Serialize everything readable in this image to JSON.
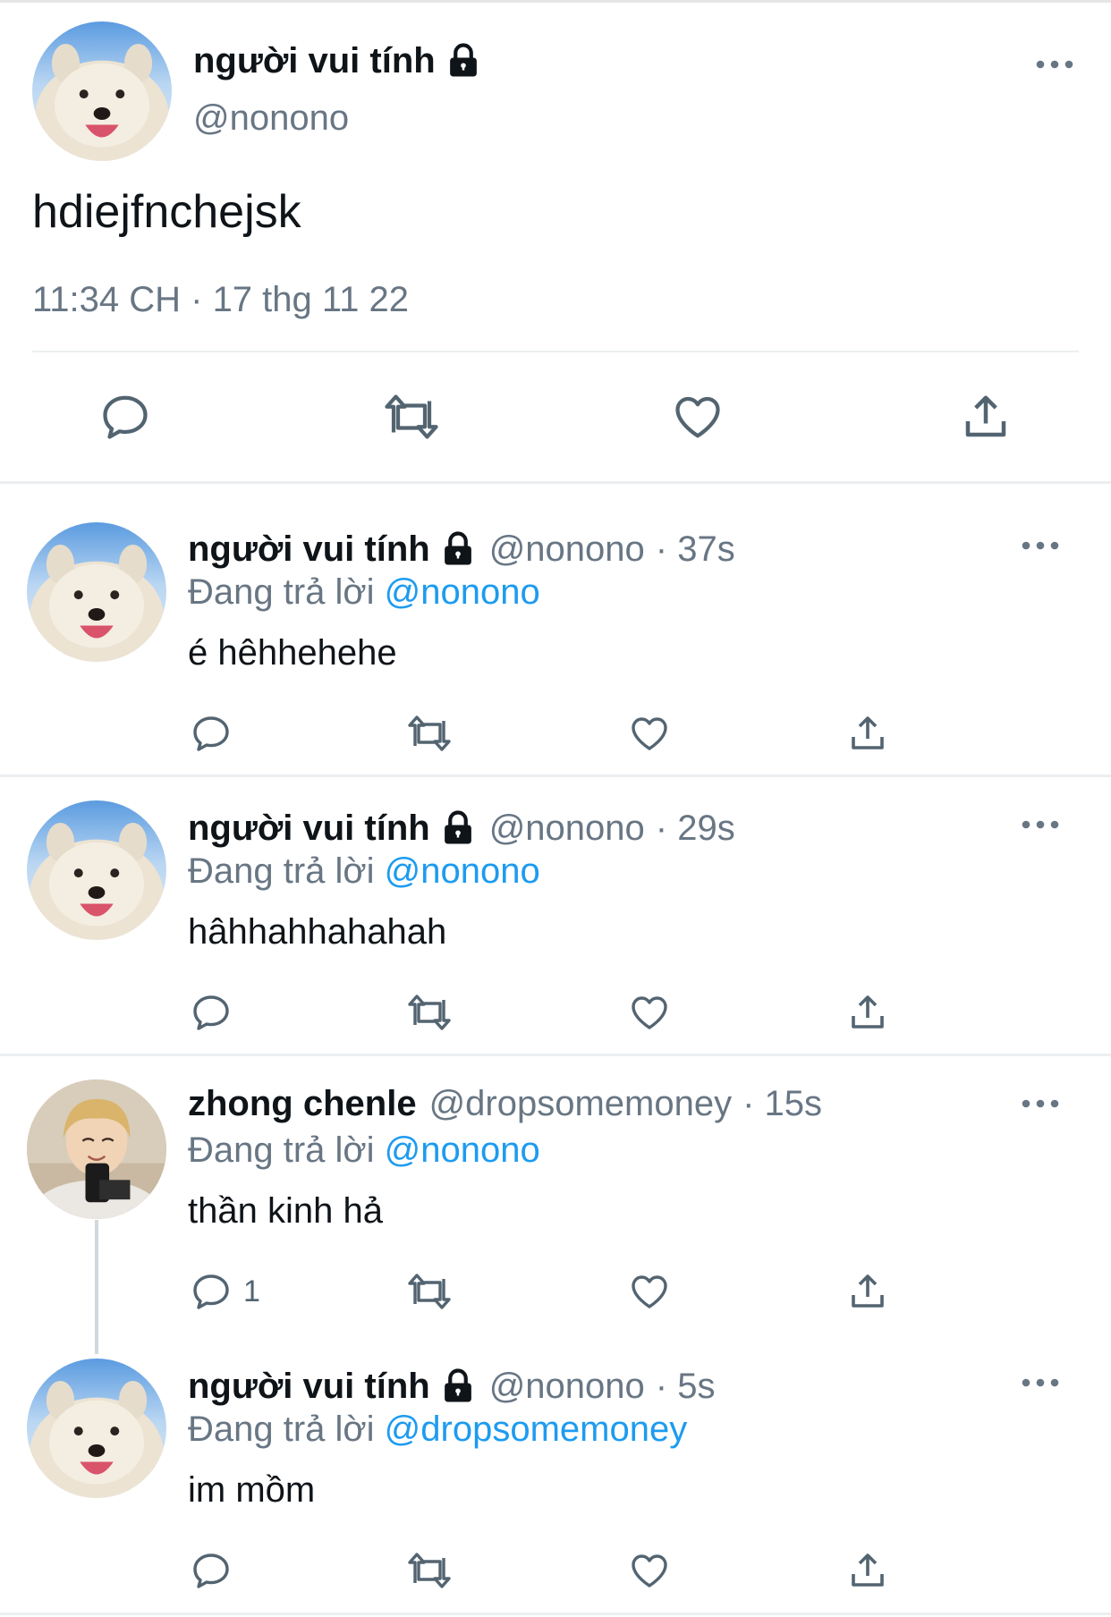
{
  "main_tweet": {
    "display_name": "người vui tính",
    "handle": "@nonono",
    "text": "hdiejfnchejsk",
    "timestamp": "11:34 CH · 17 thg 11 22",
    "icons": [
      "lock-icon",
      "more-icon",
      "reply-icon",
      "retweet-icon",
      "like-icon",
      "share-icon"
    ]
  },
  "replies": [
    {
      "display_name": "người vui tính",
      "handle": "@nonono",
      "time": "· 37s",
      "replying_prefix": "Đang trả lời",
      "replying_to": "@nonono",
      "text": "é hêhhehehe",
      "reply_count": ""
    },
    {
      "display_name": "người vui tính",
      "handle": "@nonono",
      "time": "· 29s",
      "replying_prefix": "Đang trả lời",
      "replying_to": "@nonono",
      "text": "hâhhahhahahah",
      "reply_count": ""
    },
    {
      "display_name": "zhong chenle",
      "handle": "@dropsomemoney",
      "time": "· 15s",
      "replying_prefix": "Đang trả lời",
      "replying_to": "@nonono",
      "text": "thần kinh hả",
      "reply_count": "1"
    },
    {
      "display_name": "người vui tính",
      "handle": "@nonono",
      "time": "· 5s",
      "replying_prefix": "Đang trả lời",
      "replying_to": "@dropsomemoney",
      "text": "im mồm",
      "reply_count": ""
    }
  ],
  "colors": {
    "link": "#1d9bf0",
    "muted": "#687684",
    "text": "#0f1419"
  }
}
